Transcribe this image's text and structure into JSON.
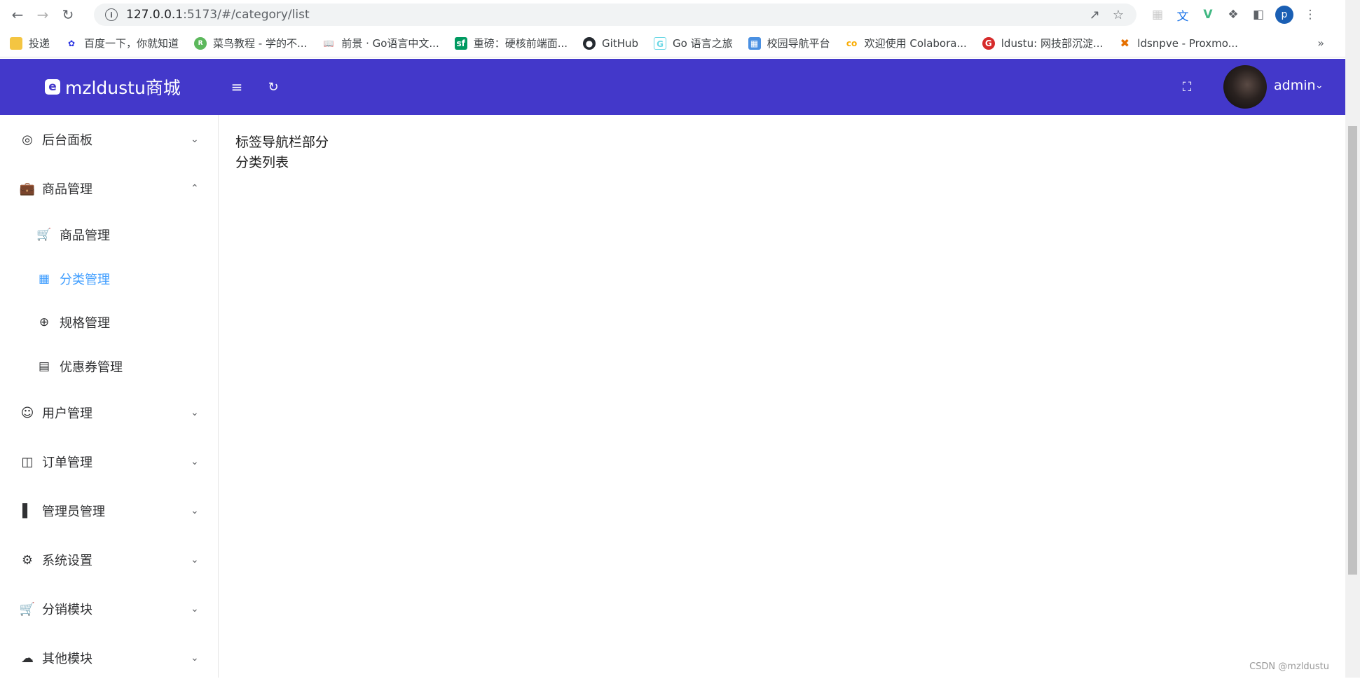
{
  "browser": {
    "url_host": "127.0.0.1",
    "url_path": ":5173/#/category/list",
    "profile_initial": "p"
  },
  "bookmarks": [
    {
      "label": "投递",
      "icon": "folder-icon",
      "color": "#f4c542"
    },
    {
      "label": "百度一下，你就知道",
      "icon": "baidu-icon",
      "color": "#2932e1"
    },
    {
      "label": "菜鸟教程 - 学的不...",
      "icon": "runoob-icon",
      "color": "#5cb85c"
    },
    {
      "label": "前景 · Go语言中文...",
      "icon": "book-icon",
      "color": "#333333"
    },
    {
      "label": "重磅：硬核前端面...",
      "icon": "segmentfault-icon",
      "color": "#009a61"
    },
    {
      "label": "GitHub",
      "icon": "github-icon",
      "color": "#24292f"
    },
    {
      "label": "Go 语言之旅",
      "icon": "gopher-icon",
      "color": "#6ad7e5"
    },
    {
      "label": "校园导航平台",
      "icon": "campus-icon",
      "color": "#4a90e2"
    },
    {
      "label": "欢迎使用 Colabora...",
      "icon": "colab-icon",
      "color": "#f9ab00"
    },
    {
      "label": "ldustu: 网技部沉淀...",
      "icon": "gitlab-icon",
      "color": "#d62b2b"
    },
    {
      "label": "ldsnpve - Proxmo...",
      "icon": "proxmox-icon",
      "color": "#e57000"
    }
  ],
  "header": {
    "logo_text": "mzldustu商城",
    "user_name": "admin",
    "accent": "#4338ca"
  },
  "sidebar": {
    "items": [
      {
        "label": "后台面板",
        "icon": "dashboard-icon",
        "expanded": false
      },
      {
        "label": "商品管理",
        "icon": "shopping-bag-icon",
        "expanded": true
      },
      {
        "label": "用户管理",
        "icon": "user-icon",
        "expanded": false
      },
      {
        "label": "订单管理",
        "icon": "inbox-icon",
        "expanded": false
      },
      {
        "label": "管理员管理",
        "icon": "books-icon",
        "expanded": false
      },
      {
        "label": "系统设置",
        "icon": "gear-icon",
        "expanded": false
      },
      {
        "label": "分销模块",
        "icon": "cart-icon",
        "expanded": false
      },
      {
        "label": "其他模块",
        "icon": "cloud-icon",
        "expanded": false
      }
    ],
    "sub_items": [
      {
        "label": "商品管理",
        "icon": "cart-icon",
        "active": false
      },
      {
        "label": "分类管理",
        "icon": "grid-icon",
        "active": true
      },
      {
        "label": "规格管理",
        "icon": "aim-icon",
        "active": false
      },
      {
        "label": "优惠券管理",
        "icon": "postcard-icon",
        "active": false
      }
    ],
    "active_color": "#409eff"
  },
  "main": {
    "line1": "标签导航栏部分",
    "line2": "分类列表"
  },
  "watermark": "CSDN @mzldustu"
}
